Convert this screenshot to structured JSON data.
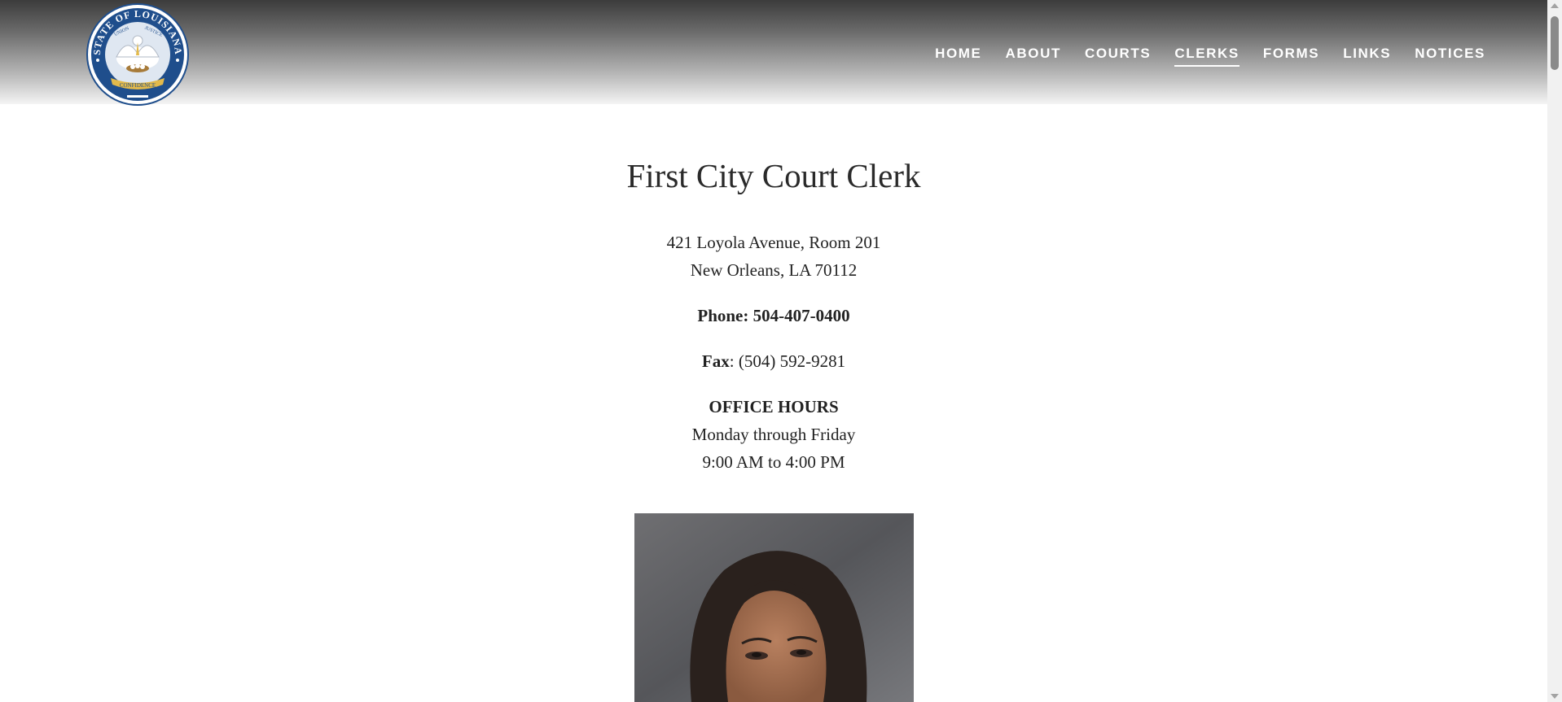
{
  "logo": {
    "ring_text_top": "STATE OF LOUISIANA",
    "banner_left": "UNION",
    "banner_right": "JUSTICE",
    "ribbon_text": "CONFIDENCE"
  },
  "nav": {
    "items": [
      {
        "label": "HOME"
      },
      {
        "label": "ABOUT"
      },
      {
        "label": "COURTS"
      },
      {
        "label": "CLERKS",
        "active": true
      },
      {
        "label": "FORMS"
      },
      {
        "label": "LINKS"
      },
      {
        "label": "NOTICES"
      }
    ]
  },
  "main": {
    "title": "First City Court Clerk",
    "address_line1": "421 Loyola Avenue, Room 201",
    "address_line2": "New Orleans, LA 70112",
    "phone": "Phone: 504-407-0400",
    "fax_label": "Fax",
    "fax_value": ": (504) 592-9281",
    "hours_heading": "OFFICE HOURS",
    "hours_days": "Monday through Friday",
    "hours_time": "9:00 AM to 4:00 PM"
  },
  "colors": {
    "seal_blue": "#1f4e8c",
    "text": "#222222",
    "header_dark": "#3c3c3c"
  }
}
